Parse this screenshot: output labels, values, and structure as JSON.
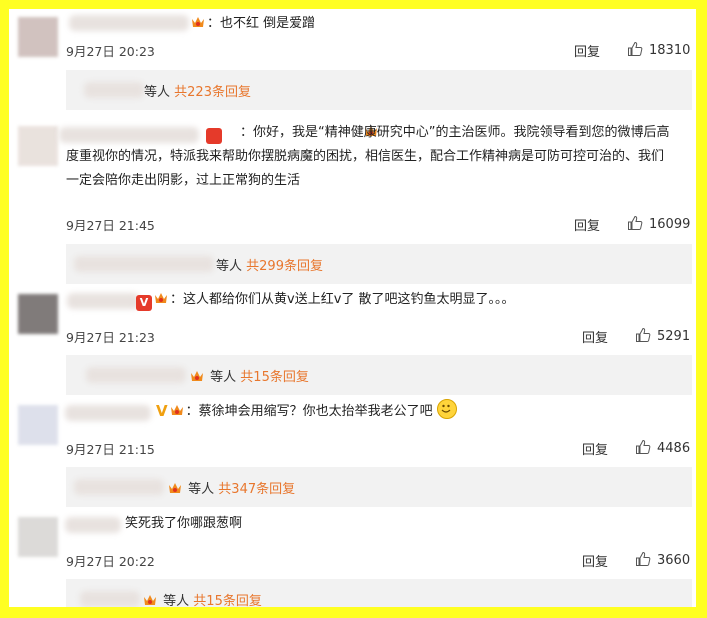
{
  "comments": [
    {
      "text": "：也不红 倒是爱蹭",
      "time": "9月27日 20:23",
      "reply": "回复",
      "likes": "18310",
      "sub_prefix": "等人",
      "sub_count": "共223条回复"
    },
    {
      "text": "：你好，我是“精神健康研究中心”的主治医师。我院领导看到您的微博后高度重视你的情况，特派我来帮助你摆脱病魔的困扰，相信医生，配合工作精神病是可防可控可治的、我们一定会陪你走出阴影，过上正常狗的生活",
      "time": "9月27日 21:45",
      "reply": "回复",
      "likes": "16099",
      "sub_prefix": "等人",
      "sub_count": "共299条回复"
    },
    {
      "text": "：这人都给你们从黄v送上红v了 散了吧这钓鱼太明显了。。。",
      "time": "9月27日 21:23",
      "reply": "回复",
      "likes": "5291",
      "sub_prefix": "等人",
      "sub_count": "共15条回复"
    },
    {
      "text": "：蔡徐坤会用缩写？你也太抬举我老公了吧",
      "time": "9月27日 21:15",
      "reply": "回复",
      "likes": "4486",
      "sub_prefix": "等人",
      "sub_count": "共347条回复"
    },
    {
      "text": "笑死我了你哪跟葱啊",
      "time": "9月27日 20:22",
      "reply": "回复",
      "likes": "3660",
      "sub_prefix": "等人",
      "sub_count": "共15条回复"
    }
  ],
  "colors": {
    "frame": "#ffff22",
    "accent_count": "#e8772e",
    "sub_bg": "#f2f2f2"
  },
  "icons": [
    "thumb-up-icon",
    "vip-badge-icon",
    "verified-v-icon",
    "smile-emoji-icon"
  ]
}
